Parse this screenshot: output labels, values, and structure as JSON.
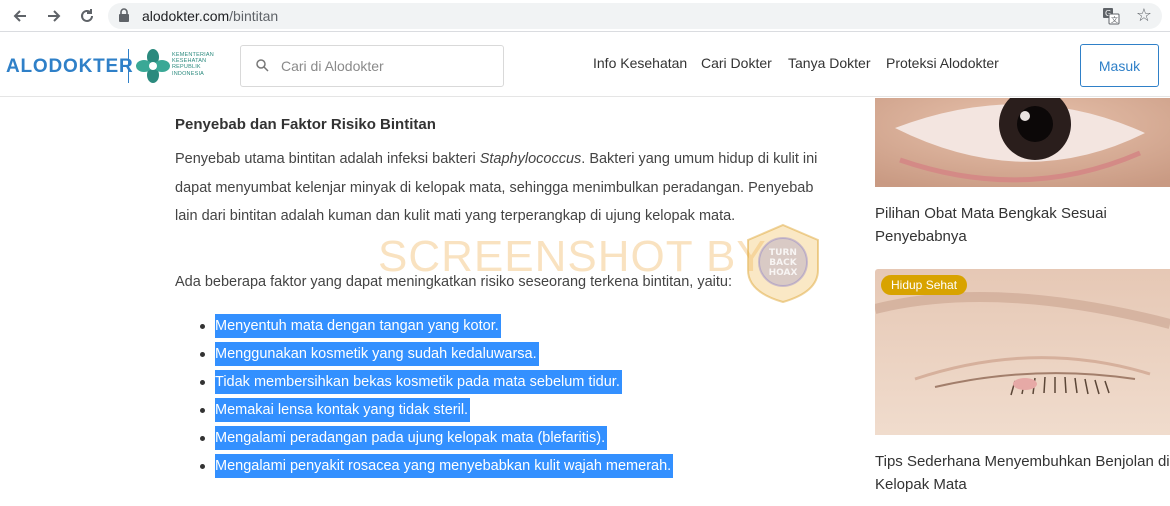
{
  "browser": {
    "url_host": "alodokter.com",
    "url_path": "/bintitan",
    "icons": [
      "back-icon",
      "forward-icon",
      "reload-icon",
      "lock-icon",
      "translate-icon",
      "star-icon"
    ]
  },
  "header": {
    "logo": "ALODOKTER",
    "partner_text": "KEMENTERIAN KESEHATAN REPUBLIK INDONESIA",
    "search_placeholder": "Cari di Alodokter",
    "nav": [
      "Info Kesehatan",
      "Cari Dokter",
      "Tanya Dokter",
      "Proteksi Alodokter"
    ],
    "login_label": "Masuk",
    "colors": {
      "brand": "#2f80c8",
      "partner_green": "#2b8a7e"
    }
  },
  "article": {
    "section_title": "Penyebab dan Faktor Risiko Bintitan",
    "para1_before": "Penyebab utama bintitan adalah infeksi bakteri ",
    "para1_italic": "Staphylococcus",
    "para1_after": ". Bakteri yang umum hidup di kulit ini dapat menyumbat kelenjar minyak di kelopak mata, sehingga menimbulkan peradangan. Penyebab lain dari bintitan adalah kuman dan kulit mati yang terperangkap di ujung kelopak mata.",
    "para2": "Ada beberapa faktor yang dapat meningkatkan risiko seseorang terkena bintitan, yaitu:",
    "risk_factors": [
      "Menyentuh mata dengan tangan yang kotor.",
      "Menggunakan kosmetik yang sudah kedaluwarsa.",
      "Tidak membersihkan bekas kosmetik pada mata sebelum tidur.",
      "Memakai lensa kontak yang tidak steril.",
      "Mengalami peradangan pada ujung kelopak mata (blefaritis).",
      "Mengalami penyakit rosacea yang menyebabkan kulit wajah memerah."
    ],
    "selection_color": "#3390ff"
  },
  "watermark": {
    "text": "SCREENSHOT BY",
    "badge_lines": [
      "TURN",
      "BACK",
      "HOAX"
    ]
  },
  "sidebar": {
    "card1_title": "Pilihan Obat Mata Bengkak Sesuai Penyebabnya",
    "card2_tag": "Hidup Sehat",
    "card2_title": "Tips Sederhana Menyembuhkan Benjolan di Kelopak Mata",
    "tag_color": "#d8a300"
  }
}
